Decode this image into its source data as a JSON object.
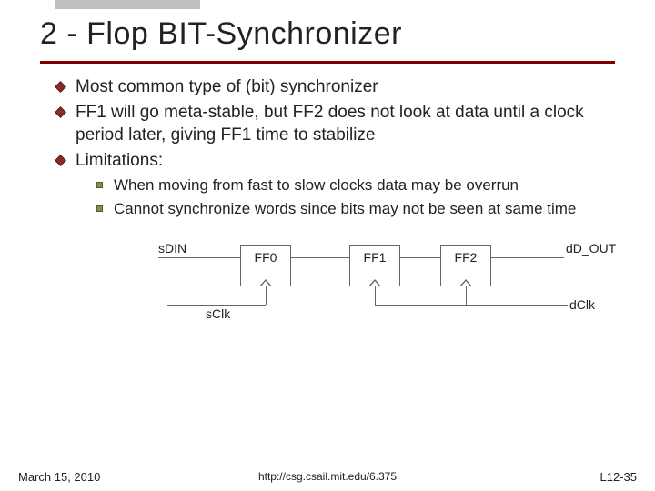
{
  "title": "2 - Flop BIT-Synchronizer",
  "bullets": [
    "Most common type of (bit) synchronizer",
    "FF1 will go meta-stable, but FF2 does not look at data until a clock period later, giving FF1 time to stabilize",
    "Limitations:"
  ],
  "sub_bullets": [
    "When moving from fast to slow clocks data may be overrun",
    "Cannot synchronize words since bits may not be seen at same time"
  ],
  "diagram": {
    "sdin": "sDIN",
    "ff0": "FF0",
    "ff1": "FF1",
    "ff2": "FF2",
    "ddout": "dD_OUT",
    "sclk": "sClk",
    "dclk": "dClk"
  },
  "footer": {
    "date": "March 15, 2010",
    "url": "http://csg.csail.mit.edu/6.375",
    "pagenum": "L12-35"
  }
}
